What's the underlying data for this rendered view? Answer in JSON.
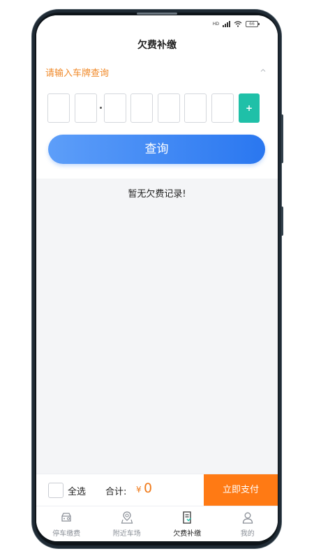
{
  "status_bar": {
    "network": "HD",
    "battery": "66"
  },
  "nav": {
    "title": "欠费补缴"
  },
  "query": {
    "heading": "请输入车牌查询",
    "plate_add_label": "+",
    "button_label": "查询"
  },
  "result": {
    "empty_text": "暂无欠费记录!"
  },
  "footer": {
    "select_all_label": "全选",
    "total_label": "合计:",
    "currency": "¥",
    "total_value": "0",
    "pay_label": "立即支付"
  },
  "tabs": [
    {
      "label": "停车缴费",
      "icon": "car-icon"
    },
    {
      "label": "附近车场",
      "icon": "location-icon"
    },
    {
      "label": "欠费补缴",
      "icon": "bill-icon"
    },
    {
      "label": "我的",
      "icon": "user-icon"
    }
  ],
  "colors": {
    "accent_orange": "#ff7a14",
    "accent_blue": "#2a77f0",
    "plate_add": "#1fc0a8"
  }
}
